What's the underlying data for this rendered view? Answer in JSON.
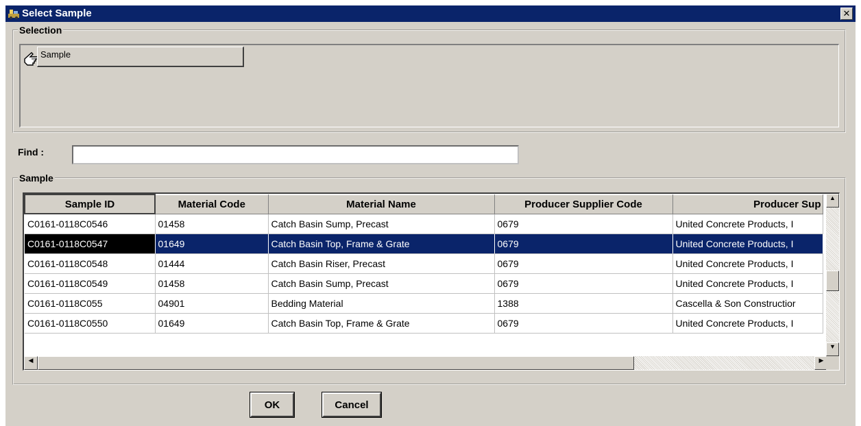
{
  "window": {
    "title": "Select Sample",
    "close_glyph": "✕"
  },
  "selection": {
    "legend": "Selection",
    "tab_label": "Sample",
    "tab_icon": "pointing-hand-icon"
  },
  "find": {
    "label": "Find :",
    "value": ""
  },
  "sample_group": {
    "legend": "Sample"
  },
  "table": {
    "columns": [
      "Sample ID",
      "Material Code",
      "Material Name",
      "Producer Supplier Code",
      "Producer Sup"
    ],
    "rows": [
      [
        "C0161-0118C0546",
        "01458",
        "Catch Basin Sump, Precast",
        "0679",
        "United Concrete Products, I"
      ],
      [
        "C0161-0118C0547",
        "01649",
        "Catch Basin Top, Frame & Grate",
        "0679",
        "United Concrete Products, I"
      ],
      [
        "C0161-0118C0548",
        "01444",
        "Catch Basin Riser, Precast",
        "0679",
        "United Concrete Products, I"
      ],
      [
        "C0161-0118C0549",
        "01458",
        "Catch Basin Sump, Precast",
        "0679",
        "United Concrete Products, I"
      ],
      [
        "C0161-0118C055",
        "04901",
        "Bedding Material",
        "1388",
        "Cascella & Son Constructior"
      ],
      [
        "C0161-0118C0550",
        "01649",
        "Catch Basin Top, Frame & Grate",
        "0679",
        "United Concrete Products, I"
      ]
    ],
    "selected_row": 1
  },
  "buttons": {
    "ok": "OK",
    "cancel": "Cancel"
  },
  "scroll_glyphs": {
    "up": "▲",
    "down": "▼",
    "left": "◀",
    "right": "▶"
  },
  "colors": {
    "titlebar": "#0a246a",
    "face": "#d4d0c8",
    "selection": "#0a246a"
  }
}
